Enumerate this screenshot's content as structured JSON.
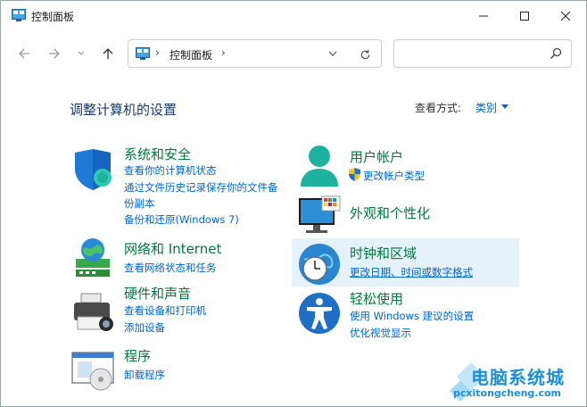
{
  "window": {
    "title": "控制面板"
  },
  "nav": {
    "address_label": "控制面板",
    "search_placeholder": ""
  },
  "header": {
    "heading": "调整计算机的设置",
    "viewby_label": "查看方式:",
    "viewby_value": "类别"
  },
  "categories": {
    "system": {
      "title": "系统和安全",
      "links": [
        "查看你的计算机状态",
        "通过文件历史记录保存你的文件备",
        "份副本",
        "备份和还原(Windows 7)"
      ]
    },
    "network": {
      "title": "网络和 Internet",
      "links": [
        "查看网络状态和任务"
      ]
    },
    "hardware": {
      "title": "硬件和声音",
      "links": [
        "查看设备和打印机",
        "添加设备"
      ]
    },
    "programs": {
      "title": "程序",
      "links": [
        "卸载程序"
      ]
    },
    "users": {
      "title": "用户帐户",
      "links": [
        "更改帐户类型"
      ]
    },
    "appearance": {
      "title": "外观和个性化",
      "links": []
    },
    "clock": {
      "title": "时钟和区域",
      "links": [
        "更改日期、时间或数字格式"
      ]
    },
    "ease": {
      "title": "轻松使用",
      "links": [
        "使用 Windows 建议的设置",
        "优化视觉显示"
      ]
    }
  },
  "watermark": {
    "title": "电脑系统城",
    "subtitle": "pcxitongcheng.com"
  },
  "colors": {
    "category_title": "#007a3d",
    "link": "#0066cc",
    "heading": "#1a3a6b",
    "hover": "#e5f1fb",
    "watermark": "#1f8fd6"
  }
}
